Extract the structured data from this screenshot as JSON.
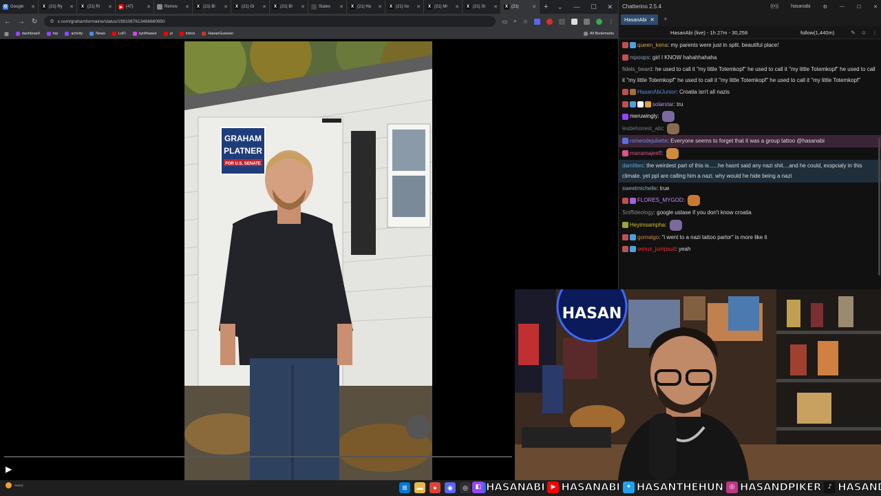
{
  "browser": {
    "tabs": [
      {
        "label": "Google",
        "color": "#4285f4",
        "glyph": "G"
      },
      {
        "label": "(21) Ry",
        "color": "#111111",
        "glyph": "X"
      },
      {
        "label": "(21) Ri",
        "color": "#111111",
        "glyph": "X"
      },
      {
        "label": "(47)",
        "color": "#ff0000",
        "glyph": "▶"
      },
      {
        "label": "Remov",
        "color": "#888888",
        "glyph": ""
      },
      {
        "label": "(21) Bi",
        "color": "#111111",
        "glyph": "X"
      },
      {
        "label": "(21) Gi",
        "color": "#111111",
        "glyph": "X"
      },
      {
        "label": "(21) Bl",
        "color": "#111111",
        "glyph": "X"
      },
      {
        "label": "States",
        "color": "#444444",
        "glyph": ""
      },
      {
        "label": "(21) Ha",
        "color": "#111111",
        "glyph": "X"
      },
      {
        "label": "(21) ho",
        "color": "#111111",
        "glyph": "X"
      },
      {
        "label": "(21) Mi",
        "color": "#111111",
        "glyph": "X"
      },
      {
        "label": "(21) St",
        "color": "#111111",
        "glyph": "X"
      },
      {
        "label": "(21)",
        "color": "#111111",
        "glyph": "X"
      }
    ],
    "new_tab_icon": "+",
    "url": "x.com/grahamformaine/status/1981087613466660950",
    "bookmarks": [
      {
        "label": "dashboard",
        "color": "#9146ff"
      },
      {
        "label": "top",
        "color": "#9146ff"
      },
      {
        "label": "activity",
        "color": "#9146ff"
      },
      {
        "label": "News",
        "color": "#4a90e2"
      },
      {
        "label": "LoFi",
        "color": "#ff0000"
      },
      {
        "label": "synthwave",
        "color": "#e040fb"
      },
      {
        "label": "yt",
        "color": "#ff0000"
      },
      {
        "label": "intros",
        "color": "#ff0000"
      },
      {
        "label": "HasanGuesser",
        "color": "#c0392b"
      }
    ],
    "all_bookmarks": "All Bookmarks",
    "video": {
      "sign_line1": "GRAHAM",
      "sign_line2": "PLATNER",
      "sign_line3": "FOR U.S. SENATE",
      "progress": 0.0
    }
  },
  "taskbar": {
    "weather_temp": "",
    "weather_desc": "Sunny",
    "icons": [
      {
        "name": "windows-icon",
        "color": "#0078d4",
        "glyph": "⊞"
      },
      {
        "name": "file-explorer-icon",
        "color": "#e8b84a",
        "glyph": "▬"
      },
      {
        "name": "chrome-icon",
        "color": "#db4437",
        "glyph": "●"
      },
      {
        "name": "discord-icon",
        "color": "#5865f2",
        "glyph": "◉"
      },
      {
        "name": "obs-icon",
        "color": "#302e31",
        "glyph": "◎"
      },
      {
        "name": "app-icon",
        "color": "#1a73e8",
        "glyph": "◆"
      }
    ]
  },
  "socials": [
    {
      "platform": "twitch",
      "handle": "HASANABI",
      "color": "#9146ff"
    },
    {
      "platform": "youtube",
      "handle": "HASANABI",
      "color": "#ff0000"
    },
    {
      "platform": "twitter",
      "handle": "HASANTHEHUN",
      "color": "#1da1f2"
    },
    {
      "platform": "instagram",
      "handle": "HASANDPIKER",
      "color": "#c13584"
    },
    {
      "platform": "tiktok",
      "handle": "HASANDPIKER",
      "color": "#111111"
    }
  ],
  "chat": {
    "app_title": "Chatterino 2.5.4",
    "current_user": "hasanabi",
    "tab_label": "HasanAbi",
    "channel_status": "HasanAbi (live) - 1h 27m - 30,258",
    "follow_label": "follow(1,440m)",
    "messages": [
      {
        "user": "queen_kena",
        "color": "#d6a84a",
        "text": "my parents were just in split. beautiful place!",
        "badges": [
          "#c05050",
          "#4aa3df"
        ],
        "hl": ""
      },
      {
        "user": "mpoops",
        "color": "#8aa0b8",
        "text": "girl I KNOW hahahhahaha",
        "badges": [
          "#c05050"
        ],
        "hl": ""
      },
      {
        "user": "fidels_beard",
        "color": "#999999",
        "text": "he used to call it \"my little Totemkopf\"  he used to call it \"my little Totemkopf\"  he used to call it \"my little Totemkopf\"  he used to call it \"my little Totemkopf\"  he used to call it \"my little Totemkopf\"",
        "badges": [],
        "hl": ""
      },
      {
        "user": "HasanAbiJunior",
        "color": "#5b8ad6",
        "text": "Croatia isn't all nazis",
        "badges": [
          "#c05050",
          "#a07040"
        ],
        "hl": ""
      },
      {
        "user": "solarstar",
        "color": "#c58af9",
        "text": "tru",
        "badges": [
          "#c05050",
          "#4aa3df",
          "#ffffff",
          "#e0a040"
        ],
        "hl": ""
      },
      {
        "user": "meruwingly",
        "color": "#e8e8e8",
        "text": "",
        "badges": [
          "#9146ff"
        ],
        "hl": ""
      },
      {
        "user": "lesbehonest_abi",
        "color": "#777777",
        "text": "",
        "badges": [],
        "hl": ""
      },
      {
        "user": "romeodejuliette",
        "color": "#6f8fe0",
        "text": "Everyone seems to forget that it was a group tattoo  @hasanabi",
        "badges": [
          "#5b6ee0"
        ],
        "hl": "hl"
      },
      {
        "user": "manamajeeff",
        "color": "#e0508a",
        "text": "",
        "badges": [
          "#e0508a"
        ],
        "hl": ""
      },
      {
        "user": "damitten",
        "color": "#5fa8d3",
        "text": "the weirdest part of this is......he hasnt said any nazi shit....and he could, exspcialy in this climate. yet ppl are calling him a nazi. why would he hide being a nazi",
        "badges": [],
        "hl": "hl2"
      },
      {
        "user": "sweetmichelle",
        "color": "#8ab0c8",
        "text": "true",
        "badges": [],
        "hl": ""
      },
      {
        "user": "FLORES_MYGOD",
        "color": "#c58af9",
        "text": "",
        "badges": [
          "#c05050",
          "#a060e0"
        ],
        "hl": ""
      },
      {
        "user": "Sniffideology",
        "color": "#888888",
        "text": "google ustase if you don't know croatia",
        "badges": [],
        "hl": ""
      },
      {
        "user": "Heyimsampha",
        "color": "#d4c030",
        "text": "",
        "badges": [
          "#a0a040"
        ],
        "hl": ""
      },
      {
        "user": "gomatgo",
        "color": "#d08a40",
        "text": "\"i went to a nazi tattoo parlor\" is more like it",
        "badges": [
          "#c05050",
          "#4aa3df"
        ],
        "hl": ""
      },
      {
        "user": "venus_jumpsuit",
        "color": "#ff2a2a",
        "text": "yeah",
        "badges": [
          "#c05050",
          "#4aa3df"
        ],
        "hl": ""
      }
    ]
  },
  "webcam": {
    "sign_text": "HASAN"
  }
}
